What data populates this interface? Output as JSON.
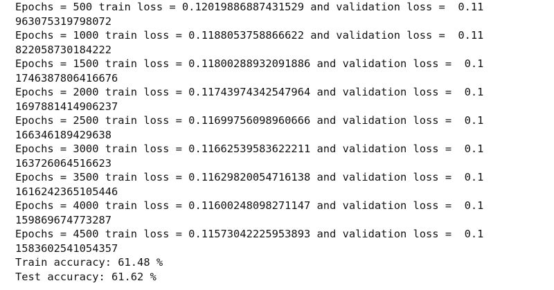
{
  "output_lines": [
    "Epochs = 500 train loss = 0.12019886887431529 and validation loss =  0.11",
    "963075319798072",
    "Epochs = 1000 train loss = 0.1188053758866622 and validation loss =  0.11",
    "822058730184222",
    "Epochs = 1500 train loss = 0.11800288932091886 and validation loss =  0.1",
    "1746387806416676",
    "Epochs = 2000 train loss = 0.11743974342547964 and validation loss =  0.1",
    "1697881414906237",
    "Epochs = 2500 train loss = 0.11699756098960666 and validation loss =  0.1",
    "166346189429638",
    "Epochs = 3000 train loss = 0.11662539583622211 and validation loss =  0.1",
    "163726064516623",
    "Epochs = 3500 train loss = 0.11629820054716138 and validation loss =  0.1",
    "1616242365105446",
    "Epochs = 4000 train loss = 0.11600248098271147 and validation loss =  0.1",
    "159869674773287",
    "Epochs = 4500 train loss = 0.11573042225953893 and validation loss =  0.1",
    "1583602541054357"
  ],
  "summary": {
    "train_accuracy": "Train accuracy: 61.48 %",
    "test_accuracy": "Test accuracy: 61.62 %"
  }
}
